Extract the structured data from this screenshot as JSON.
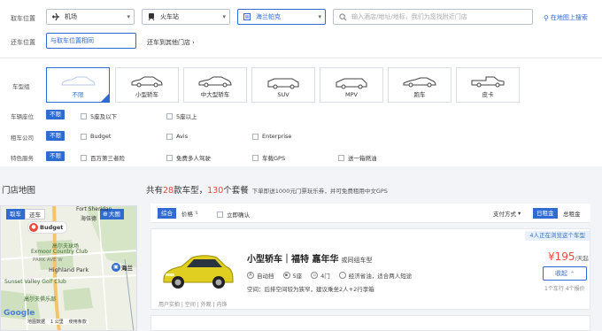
{
  "search": {
    "pickup_label": "取车位置",
    "return_label": "还车位置",
    "pickup_type": "机场",
    "pickup_station": "火车站",
    "pickup_hotel": "海兰帕克",
    "address_placeholder": "输入酒店/地址/地标，我们为您找附近门店",
    "map_search": "在地图上搜索",
    "return_same": "与取车位置相同",
    "return_other": "还车到其他门店"
  },
  "filters": {
    "cartype_label": "车型组",
    "cartypes": [
      {
        "name": "不限",
        "selected": true
      },
      {
        "name": "小型轿车"
      },
      {
        "name": "中大型轿车"
      },
      {
        "name": "SUV"
      },
      {
        "name": "MPV"
      },
      {
        "name": "跑车"
      },
      {
        "name": "皮卡"
      }
    ],
    "seats_label": "车辆座位",
    "seats_all": "不限",
    "seats_options": [
      "5座及以下",
      "5座以上"
    ],
    "company_label": "租车公司",
    "company_all": "不限",
    "company_options": [
      "Budget",
      "Avis",
      "Enterprise"
    ],
    "service_label": "特色服务",
    "service_all": "不限",
    "service_options": [
      "百万第三者险",
      "免费多人驾驶",
      "车载GPS",
      "送一箱燃油"
    ]
  },
  "map": {
    "title": "门店地图",
    "tab_pickup": "取车",
    "tab_return": "还车",
    "enlarge": "大图",
    "labels": [
      "Fort Sheridan",
      "海伍德",
      "Budget",
      "高尔夫球场",
      "Exmoor Country Club",
      "PARK AVE W",
      "Highland Park",
      "Sunset Valley Golf Club",
      "高尔夫俱乐部",
      "海兰",
      "Google",
      "地图数据",
      "1 公里",
      "使用条款"
    ]
  },
  "results": {
    "prefix": "共有",
    "count": "28",
    "mid": "款车型，",
    "packages": "130",
    "suffix": "个套餐",
    "promo": "下单即送1000元门票玩乐券，并可免费租用中文GPS",
    "sort": {
      "composite": "综合",
      "price": "价格",
      "instant": "立即确认",
      "payment": "支付方式",
      "daily": "日租金",
      "total": "总租金"
    }
  },
  "car": {
    "notice": "4人正在浏览这个车型",
    "title": "小型轿车｜福特 嘉年华",
    "similar": "或同组车型",
    "features": [
      "自动挡",
      "5座",
      "4门",
      "经济省油，适合两人短途"
    ],
    "space": "空间：后排空间较为狭窄，建议乘坐2人+2行李箱",
    "photo_tags": "用户实拍 | 空间 | 外观 | 内饰",
    "price": "¥195",
    "price_unit": "/天起",
    "collapse": "收起",
    "meta": "1个车行  4个报价"
  },
  "colors": {
    "accent": "#2f6bd0",
    "price": "#e84b3a"
  }
}
